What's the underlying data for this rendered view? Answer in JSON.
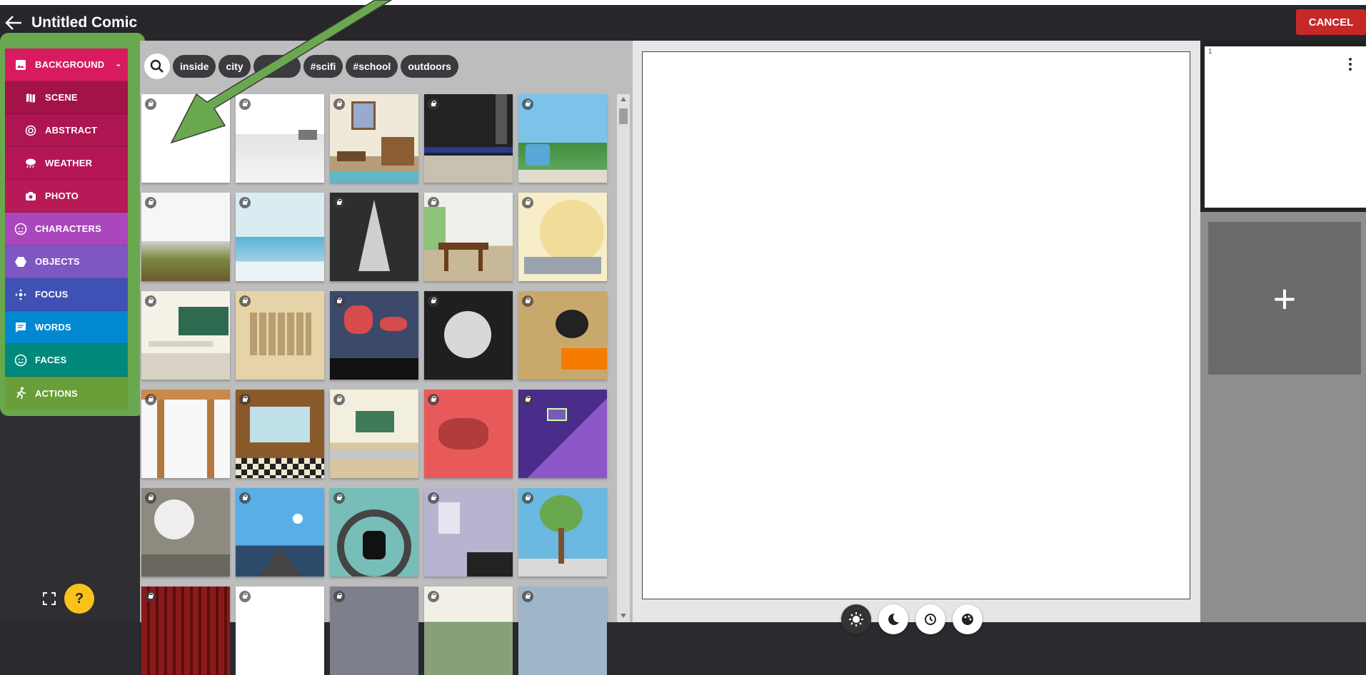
{
  "app": {
    "title": "Untitled Comic",
    "cancel_label": "CANCEL"
  },
  "menu": [
    {
      "label": "BACKGROUND",
      "color": "#d81b60",
      "icon": "image-icon",
      "expanded": true
    },
    {
      "label": "SCENE",
      "color": "#a3134a",
      "icon": "map-icon",
      "sub": true
    },
    {
      "label": "ABSTRACT",
      "color": "#ad1651",
      "icon": "spiral-icon",
      "sub": true
    },
    {
      "label": "WEATHER",
      "color": "#b41655",
      "icon": "weather-icon",
      "sub": true
    },
    {
      "label": "PHOTO",
      "color": "#b81a57",
      "icon": "camera-icon",
      "sub": true
    },
    {
      "label": "CHARACTERS",
      "color": "#ab47bc",
      "icon": "face-icon"
    },
    {
      "label": "OBJECTS",
      "color": "#7e57c2",
      "icon": "hexagon-icon"
    },
    {
      "label": "FOCUS",
      "color": "#3f51b5",
      "icon": "move-icon"
    },
    {
      "label": "WORDS",
      "color": "#0288d1",
      "icon": "speech-bubble-icon"
    },
    {
      "label": "FACES",
      "color": "#00897b",
      "icon": "smiley-icon"
    },
    {
      "label": "ACTIONS",
      "color": "#689f38",
      "icon": "running-icon"
    }
  ],
  "search": {
    "tags": [
      "inside",
      "city",
      "",
      "#scifi",
      "#school",
      "outdoors"
    ]
  },
  "help_label": "?",
  "panel": {
    "number": "1"
  },
  "add_panel_label": "+",
  "colors": {
    "highlight": "#6aa84f",
    "arrow": "#6aa84f",
    "cancel": "#c62828",
    "help": "#f9c21a"
  }
}
